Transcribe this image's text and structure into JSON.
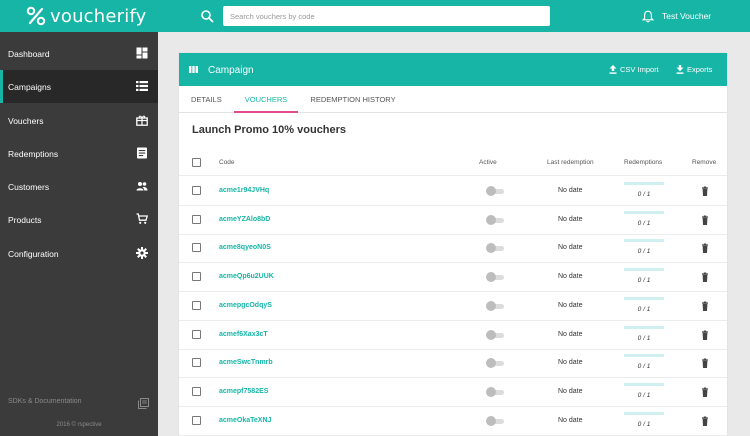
{
  "brand": {
    "name": "voucherify",
    "accent": "#16b5a6",
    "sidebar_bg": "#3b3b3b",
    "tab_underline": "#e24a8b"
  },
  "search": {
    "placeholder": "Search vouchers by code",
    "icon": "search-icon"
  },
  "header": {
    "user_name": "Test Voucher",
    "bell_icon": "bell-icon"
  },
  "sidebar": {
    "items": [
      {
        "label": "Dashboard",
        "icon": "dashboard-icon"
      },
      {
        "label": "Campaigns",
        "icon": "list-icon",
        "active": true
      },
      {
        "label": "Vouchers",
        "icon": "gift-icon"
      },
      {
        "label": "Redemptions",
        "icon": "document-icon"
      },
      {
        "label": "Customers",
        "icon": "people-icon"
      },
      {
        "label": "Products",
        "icon": "cart-icon"
      },
      {
        "label": "Configuration",
        "icon": "gear-icon"
      }
    ],
    "sdk_label": "SDKs & Documentation",
    "copyright": "2016 © rspective"
  },
  "card": {
    "title": "Campaign",
    "csv_label": "CSV Import",
    "exports_label": "Exports",
    "tabs": [
      "DETAILS",
      "VOUCHERS",
      "REDEMPTION HISTORY"
    ],
    "active_tab": "VOUCHERS",
    "section_title": "Launch Promo 10% vouchers"
  },
  "table": {
    "columns": {
      "code": "Code",
      "active": "Active",
      "last_redemption": "Last redemption",
      "redemptions": "Redemptions",
      "remove": "Remove"
    },
    "rows": [
      {
        "code": "acme1r94JVHq",
        "active": false,
        "last": "No date",
        "redemptions": "0 / 1",
        "redeemed_fraction": 0
      },
      {
        "code": "acmeYZAlo8bD",
        "active": false,
        "last": "No date",
        "redemptions": "0 / 1",
        "redeemed_fraction": 0
      },
      {
        "code": "acme8qyeoN0S",
        "active": false,
        "last": "No date",
        "redemptions": "0 / 1",
        "redeemed_fraction": 0
      },
      {
        "code": "acmeQp6u2UUK",
        "active": false,
        "last": "No date",
        "redemptions": "0 / 1",
        "redeemed_fraction": 0
      },
      {
        "code": "acmepgcOdqyS",
        "active": false,
        "last": "No date",
        "redemptions": "0 / 1",
        "redeemed_fraction": 0
      },
      {
        "code": "acmef6Xax3cT",
        "active": false,
        "last": "No date",
        "redemptions": "0 / 1",
        "redeemed_fraction": 0
      },
      {
        "code": "acmeSwcTnmrb",
        "active": false,
        "last": "No date",
        "redemptions": "0 / 1",
        "redeemed_fraction": 0
      },
      {
        "code": "acmepf7582ES",
        "active": false,
        "last": "No date",
        "redemptions": "0 / 1",
        "redeemed_fraction": 0
      },
      {
        "code": "acmeOkaTeXNJ",
        "active": false,
        "last": "No date",
        "redemptions": "0 / 1",
        "redeemed_fraction": 0
      }
    ]
  }
}
